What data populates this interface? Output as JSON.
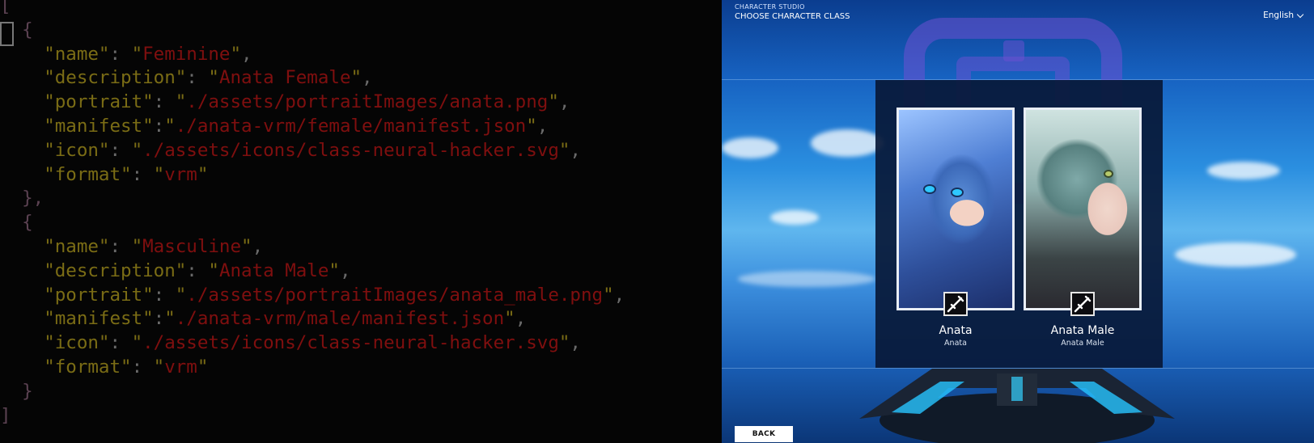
{
  "editor": {
    "lines": [
      [
        {
          "t": "[",
          "c": "punct"
        }
      ],
      [
        {
          "t": "  {",
          "c": "punct"
        }
      ],
      [
        {
          "t": "    ",
          "c": "pl"
        },
        {
          "t": "\"name\"",
          "c": "key"
        },
        {
          "t": ": ",
          "c": "pl"
        },
        {
          "t": "\"",
          "c": "key"
        },
        {
          "t": "Feminine",
          "c": "str"
        },
        {
          "t": "\"",
          "c": "key"
        },
        {
          "t": ",",
          "c": "pl"
        }
      ],
      [
        {
          "t": "    ",
          "c": "pl"
        },
        {
          "t": "\"description\"",
          "c": "key"
        },
        {
          "t": ": ",
          "c": "pl"
        },
        {
          "t": "\"",
          "c": "key"
        },
        {
          "t": "Anata Female",
          "c": "str"
        },
        {
          "t": "\"",
          "c": "key"
        },
        {
          "t": ",",
          "c": "pl"
        }
      ],
      [
        {
          "t": "    ",
          "c": "pl"
        },
        {
          "t": "\"portrait\"",
          "c": "key"
        },
        {
          "t": ": ",
          "c": "pl"
        },
        {
          "t": "\"",
          "c": "key"
        },
        {
          "t": "./assets/portraitImages/anata.png",
          "c": "str"
        },
        {
          "t": "\"",
          "c": "key"
        },
        {
          "t": ",",
          "c": "pl"
        }
      ],
      [
        {
          "t": "    ",
          "c": "pl"
        },
        {
          "t": "\"manifest\"",
          "c": "key"
        },
        {
          "t": ":",
          "c": "pl"
        },
        {
          "t": "\"",
          "c": "key"
        },
        {
          "t": "./anata-vrm/female/manifest.json",
          "c": "str"
        },
        {
          "t": "\"",
          "c": "key"
        },
        {
          "t": ",",
          "c": "pl"
        }
      ],
      [
        {
          "t": "    ",
          "c": "pl"
        },
        {
          "t": "\"icon\"",
          "c": "key"
        },
        {
          "t": ": ",
          "c": "pl"
        },
        {
          "t": "\"",
          "c": "key"
        },
        {
          "t": "./assets/icons/class-neural-hacker.svg",
          "c": "str"
        },
        {
          "t": "\"",
          "c": "key"
        },
        {
          "t": ",",
          "c": "pl"
        }
      ],
      [
        {
          "t": "    ",
          "c": "pl"
        },
        {
          "t": "\"format\"",
          "c": "key"
        },
        {
          "t": ": ",
          "c": "pl"
        },
        {
          "t": "\"",
          "c": "key"
        },
        {
          "t": "vrm",
          "c": "str"
        },
        {
          "t": "\"",
          "c": "key"
        }
      ],
      [
        {
          "t": "  },",
          "c": "punct"
        }
      ],
      [
        {
          "t": "  {",
          "c": "punct"
        }
      ],
      [
        {
          "t": "    ",
          "c": "pl"
        },
        {
          "t": "\"name\"",
          "c": "key"
        },
        {
          "t": ": ",
          "c": "pl"
        },
        {
          "t": "\"",
          "c": "key"
        },
        {
          "t": "Masculine",
          "c": "str"
        },
        {
          "t": "\"",
          "c": "key"
        },
        {
          "t": ",",
          "c": "pl"
        }
      ],
      [
        {
          "t": "    ",
          "c": "pl"
        },
        {
          "t": "\"description\"",
          "c": "key"
        },
        {
          "t": ": ",
          "c": "pl"
        },
        {
          "t": "\"",
          "c": "key"
        },
        {
          "t": "Anata Male",
          "c": "str"
        },
        {
          "t": "\"",
          "c": "key"
        },
        {
          "t": ",",
          "c": "pl"
        }
      ],
      [
        {
          "t": "    ",
          "c": "pl"
        },
        {
          "t": "\"portrait\"",
          "c": "key"
        },
        {
          "t": ": ",
          "c": "pl"
        },
        {
          "t": "\"",
          "c": "key"
        },
        {
          "t": "./assets/portraitImages/anata_male.png",
          "c": "str"
        },
        {
          "t": "\"",
          "c": "key"
        },
        {
          "t": ",",
          "c": "pl"
        }
      ],
      [
        {
          "t": "    ",
          "c": "pl"
        },
        {
          "t": "\"manifest\"",
          "c": "key"
        },
        {
          "t": ":",
          "c": "pl"
        },
        {
          "t": "\"",
          "c": "key"
        },
        {
          "t": "./anata-vrm/male/manifest.json",
          "c": "str"
        },
        {
          "t": "\"",
          "c": "key"
        },
        {
          "t": ",",
          "c": "pl"
        }
      ],
      [
        {
          "t": "    ",
          "c": "pl"
        },
        {
          "t": "\"icon\"",
          "c": "key"
        },
        {
          "t": ": ",
          "c": "pl"
        },
        {
          "t": "\"",
          "c": "key"
        },
        {
          "t": "./assets/icons/class-neural-hacker.svg",
          "c": "str"
        },
        {
          "t": "\"",
          "c": "key"
        },
        {
          "t": ",",
          "c": "pl"
        }
      ],
      [
        {
          "t": "    ",
          "c": "pl"
        },
        {
          "t": "\"format\"",
          "c": "key"
        },
        {
          "t": ": ",
          "c": "pl"
        },
        {
          "t": "\"",
          "c": "key"
        },
        {
          "t": "vrm",
          "c": "str"
        },
        {
          "t": "\"",
          "c": "key"
        }
      ],
      [
        {
          "t": "  }",
          "c": "punct"
        }
      ],
      [
        {
          "t": "]",
          "c": "punct"
        }
      ]
    ]
  },
  "app": {
    "studio_label": "CHARACTER STUDIO",
    "page_title": "CHOOSE CHARACTER CLASS",
    "language": "English",
    "back_label": "BACK",
    "cards": [
      {
        "name": "Anata",
        "subtitle": "Anata",
        "icon": "neural-hacker-class-icon"
      },
      {
        "name": "Anata Male",
        "subtitle": "Anata Male",
        "icon": "neural-hacker-class-icon"
      }
    ]
  },
  "colors": {
    "json_key": "#7a6c15",
    "json_string": "#7f0f0f",
    "json_bracket": "#5b4252",
    "panel": "#081837",
    "emblem": "#6e50d2"
  }
}
